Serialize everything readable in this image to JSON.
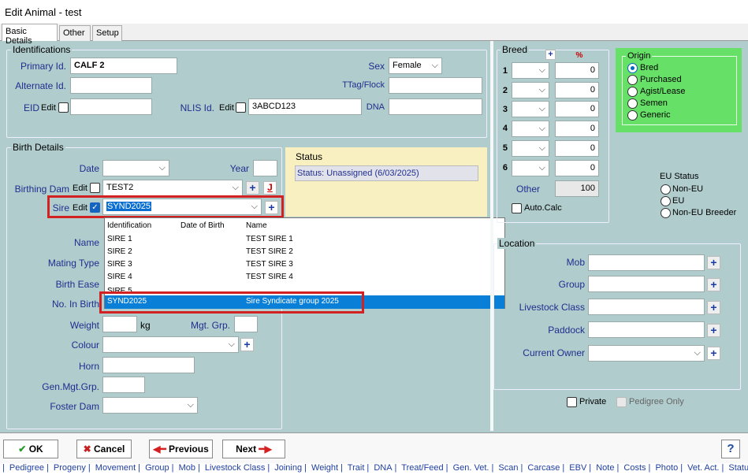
{
  "window": {
    "title": "Edit Animal - test"
  },
  "tabs": [
    {
      "label": "Basic Details"
    },
    {
      "label": "Other"
    },
    {
      "label": "Setup"
    }
  ],
  "identifications": {
    "title": "Identifications",
    "primary_label": "Primary Id.",
    "primary_value": "CALF 2",
    "alternate_label": "Alternate Id.",
    "alternate_value": "",
    "eid_label": "EID",
    "edit_label": "Edit",
    "eid_value": "",
    "nlis_label": "NLIS Id.",
    "nlis_value": "3ABCD123",
    "sex_label": "Sex",
    "sex_value": "Female",
    "ttag_label": "TTag/Flock",
    "ttag_value": "",
    "dna_label": "DNA",
    "dna_value": ""
  },
  "birth": {
    "title": "Birth Details",
    "date_label": "Date",
    "date_value": "",
    "year_label": "Year",
    "year_value": "",
    "dam_label": "Birthing Dam",
    "dam_value": "TEST2",
    "sire_label": "Sire",
    "sire_value": "SYND2025",
    "name_label": "Name",
    "mating_label": "Mating Type",
    "ease_label": "Birth Ease",
    "nobirth_label": "No. In Birth",
    "weight_label": "Weight",
    "weight_unit": "kg",
    "mgt_label": "Mgt. Grp.",
    "colour_label": "Colour",
    "horn_label": "Horn",
    "genmgt_label": "Gen.Mgt.Grp.",
    "foster_label": "Foster Dam",
    "dam_j": "J"
  },
  "status": {
    "title": "Status",
    "text": "Status: Unassigned (6/03/2025)"
  },
  "sire_dropdown": {
    "headers": [
      "Identification",
      "Date of Birth",
      "Name"
    ],
    "rows": [
      {
        "id": "SIRE 1",
        "dob": "",
        "name": "TEST SIRE 1"
      },
      {
        "id": "SIRE 2",
        "dob": "",
        "name": "TEST SIRE 2"
      },
      {
        "id": "SIRE 3",
        "dob": "",
        "name": "TEST SIRE 3"
      },
      {
        "id": "SIRE 4",
        "dob": "",
        "name": "TEST SIRE 4"
      },
      {
        "id": "SIRE 5",
        "dob": "",
        "name": ""
      },
      {
        "id": "SYND2025",
        "dob": "",
        "name": "Sire Syndicate group 2025"
      }
    ]
  },
  "breed": {
    "title": "Breed",
    "percent_label": "%",
    "rows": [
      {
        "n": "1",
        "pct": "0"
      },
      {
        "n": "2",
        "pct": "0"
      },
      {
        "n": "3",
        "pct": "0"
      },
      {
        "n": "4",
        "pct": "0"
      },
      {
        "n": "5",
        "pct": "0"
      },
      {
        "n": "6",
        "pct": "0"
      }
    ],
    "other_label": "Other",
    "other_value": "100",
    "autocalc_label": "Auto.Calc"
  },
  "origin": {
    "title": "Origin",
    "options": [
      "Bred",
      "Purchased",
      "Agist/Lease",
      "Semen",
      "Generic"
    ],
    "selected": "Bred"
  },
  "eu_status": {
    "title": "EU Status",
    "options": [
      "Non-EU",
      "EU",
      "Non-EU Breeder"
    ]
  },
  "location": {
    "title": "Location",
    "mob_label": "Mob",
    "group_label": "Group",
    "class_label": "Livestock Class",
    "paddock_label": "Paddock",
    "owner_label": "Current Owner"
  },
  "flags": {
    "private_label": "Private",
    "pedigree_label": "Pedigree Only"
  },
  "buttons": {
    "ok": "OK",
    "cancel": "Cancel",
    "previous": "Previous",
    "next": "Next",
    "help": "?"
  },
  "bottom_links": [
    "Pedigree",
    "Progeny",
    "Movement",
    "Group",
    "Mob",
    "Livestock Class",
    "Joining",
    "Weight",
    "Trait",
    "DNA",
    "Treat/Feed",
    "Gen. Vet.",
    "Scan",
    "Carcase",
    "EBV",
    "Note",
    "Costs",
    "Photo",
    "Vet. Act.",
    "Status Hist."
  ],
  "colors": {
    "background": "#b0cccc",
    "label_blue": "#1f2f8f",
    "origin_green": "#66e066",
    "highlight_red": "#d32020",
    "status_yellow": "#f8f0c0"
  }
}
